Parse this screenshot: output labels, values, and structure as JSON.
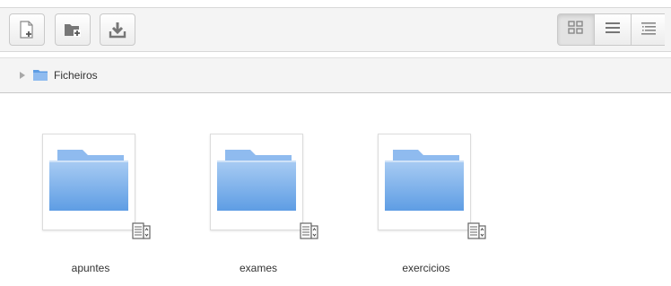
{
  "toolbar": {
    "buttons": [
      {
        "icon": "new-file-icon"
      },
      {
        "icon": "new-folder-icon"
      },
      {
        "icon": "download-icon"
      }
    ],
    "view_modes": [
      {
        "icon": "grid-view-icon",
        "active": true
      },
      {
        "icon": "list-view-icon",
        "active": false
      },
      {
        "icon": "tree-view-icon",
        "active": false
      }
    ]
  },
  "breadcrumb": {
    "root_label": "Ficheiros"
  },
  "folders": [
    {
      "name": "apuntes"
    },
    {
      "name": "exames"
    },
    {
      "name": "exercicios"
    }
  ],
  "colors": {
    "folder_light": "#a9ccf3",
    "folder_dark": "#5e9de4",
    "folder_tab": "#8fbbef"
  }
}
